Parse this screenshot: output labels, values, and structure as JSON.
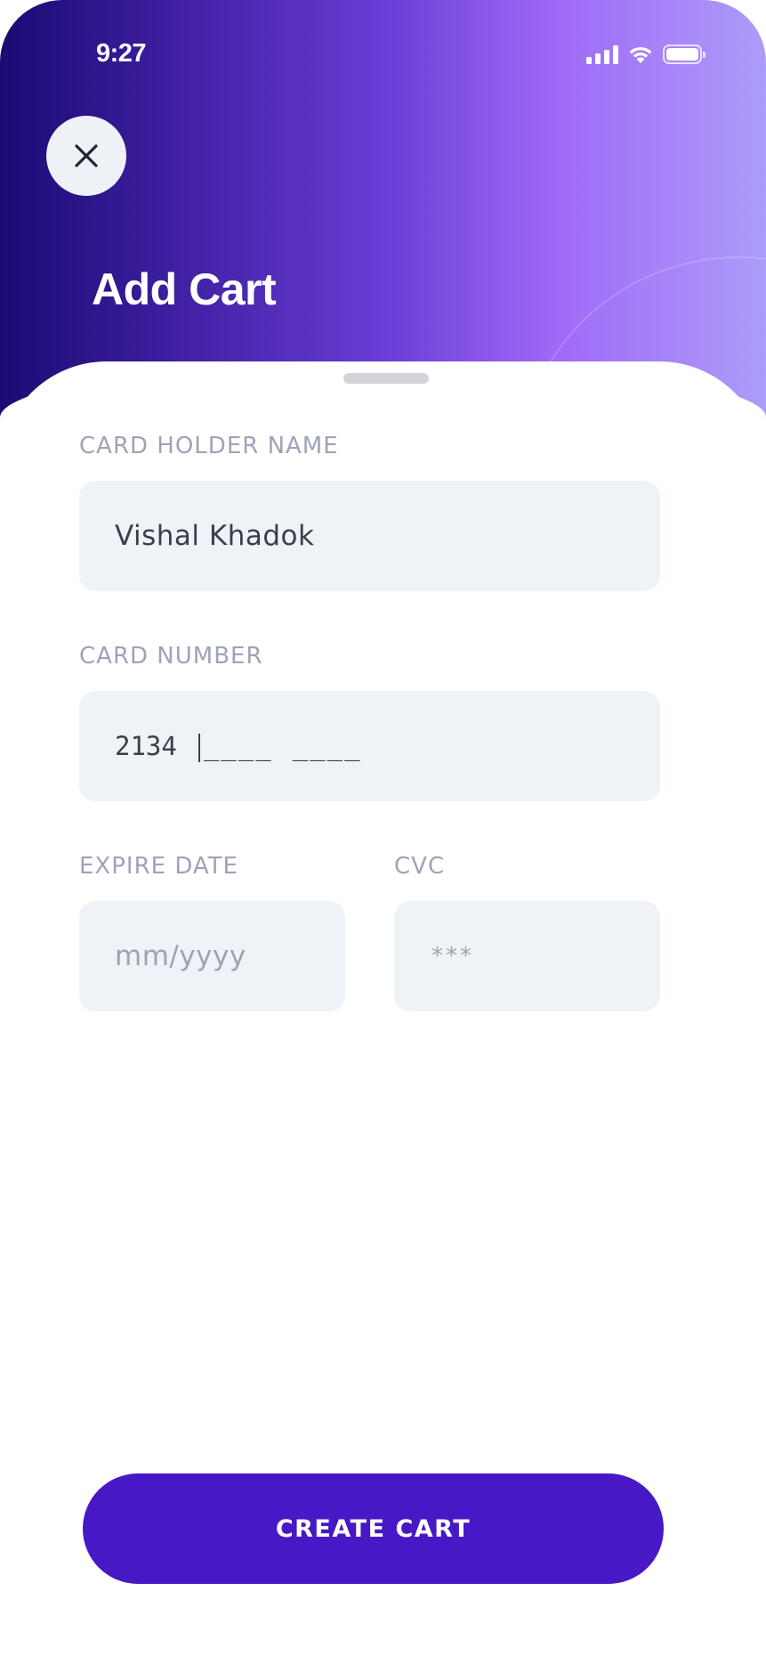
{
  "status_bar": {
    "time": "9:27"
  },
  "header": {
    "title": "Add Cart",
    "close_icon": "close-icon"
  },
  "form": {
    "holder": {
      "label": "CARD HOLDER NAME",
      "value": "Vishal Khadok"
    },
    "number": {
      "label": "CARD NUMBER",
      "digits": "2134",
      "mask_group_1": "____",
      "mask_group_2": "____"
    },
    "expire": {
      "label": "EXPIRE DATE",
      "placeholder": "mm/yyyy"
    },
    "cvc": {
      "label": "CVC",
      "placeholder": "***"
    }
  },
  "actions": {
    "create_label": "CREATE CART"
  },
  "colors": {
    "accent": "#4718c6",
    "gradient_start": "#1b0b73",
    "gradient_end": "#ad9cf9",
    "field_bg": "#eff3f8",
    "label": "#9ea3b8"
  }
}
